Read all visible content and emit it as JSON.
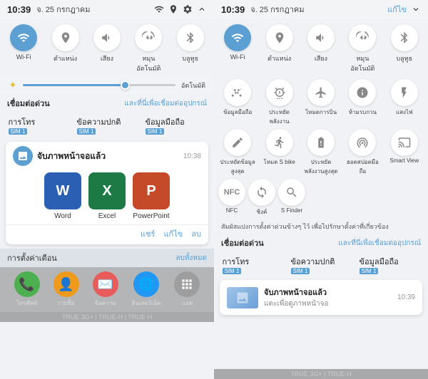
{
  "left": {
    "statusBar": {
      "time": "10:39",
      "date": "จ. 25 กรกฎาคม"
    },
    "toggles": [
      {
        "id": "wifi",
        "label": "Wi-Fi",
        "active": true
      },
      {
        "id": "location",
        "label": "ตำแหน่ง",
        "active": false
      },
      {
        "id": "sound",
        "label": "เสียง",
        "active": true
      },
      {
        "id": "auto-rotate",
        "label": "หมุนอัตโนมัติ",
        "active": false
      },
      {
        "id": "bluetooth",
        "label": "บลูทูธ",
        "active": false
      }
    ],
    "brightness": {
      "label": "อัตโนมัติ"
    },
    "connectSection": {
      "title": "เชื่อมต่อด่วน",
      "link": "และที่นี่เพื่อเชื่อมต่ออุปกรณ์"
    },
    "connections": [
      {
        "name": "การโทร",
        "sim": "SIM 1"
      },
      {
        "name": "ข้อความปกติ",
        "sim": "SIM 1"
      },
      {
        "name": "ข้อมูลมือถือ",
        "sim": "SIM 1"
      }
    ],
    "notification": {
      "title": "จับภาพหน้าจอแล้ว",
      "time": "10:38",
      "apps": [
        {
          "name": "Word",
          "icon": "W"
        },
        {
          "name": "Excel",
          "icon": "X"
        },
        {
          "name": "PowerPoint",
          "icon": "P"
        }
      ],
      "actions": [
        "แชร์",
        "แก้ไข",
        "ลบ"
      ]
    },
    "bottomBar": {
      "label": "การตั้งค่าเตือน",
      "link": "ลบทั้งหมด"
    },
    "dock": [
      {
        "label": "โทรศัพท์",
        "icon": "📞"
      },
      {
        "label": "รายชื่อ",
        "icon": "👤"
      },
      {
        "label": "ข้อความ",
        "icon": "✉️"
      },
      {
        "label": "อินเทอร์เน็ต",
        "icon": "🌐"
      },
      {
        "label": "แอพ",
        "icon": "⊞"
      }
    ],
    "statusBottom": "TRUE 3G+ | TRUE-H | TRUE-H"
  },
  "right": {
    "statusBar": {
      "time": "10:39",
      "date": "จ. 25 กรกฎาคม"
    },
    "editButton": "แก้ไข",
    "toggles": [
      {
        "id": "wifi",
        "label": "Wi-Fi",
        "active": true
      },
      {
        "id": "location",
        "label": "ตำแหน่ง",
        "active": false
      },
      {
        "id": "sound",
        "label": "เสียง",
        "active": true
      },
      {
        "id": "auto-rotate",
        "label": "หมุนอัตโนมัติ",
        "active": false
      },
      {
        "id": "bluetooth",
        "label": "บลูทูธ",
        "active": false
      }
    ],
    "extraToggles1": [
      {
        "id": "mobile-data",
        "label": "ข้อมูลมือถือ",
        "active": false
      },
      {
        "id": "power-save",
        "label": "ประหยัดพลังงาน",
        "active": false
      },
      {
        "id": "flight",
        "label": "โหมดการบิน",
        "active": false
      },
      {
        "id": "dnd",
        "label": "ห้ามรบกวน",
        "active": false
      },
      {
        "id": "torch",
        "label": "แสงไฟ",
        "active": false
      }
    ],
    "extraToggles2": [
      {
        "id": "data-save",
        "label": "ประหยัดข้อมูลสูงสุด",
        "active": false
      },
      {
        "id": "s-bike",
        "label": "โหมด S bike",
        "active": false
      },
      {
        "id": "data-save2",
        "label": "ประหยัดพลังงานสูงสุด",
        "active": false
      },
      {
        "id": "hotspot",
        "label": "ฮอตสปอตมือถือ",
        "active": false
      },
      {
        "id": "smart-view",
        "label": "Smart View",
        "active": false
      }
    ],
    "nfcRow": [
      {
        "id": "nfc",
        "label": "NFC",
        "active": false
      },
      {
        "id": "sync",
        "label": "ซิงค์",
        "active": false
      },
      {
        "id": "s-finder",
        "label": "S Finder",
        "active": false
      }
    ],
    "infoText": "สัมผัสแปงการตั้งค่าด่วนข้างๆ ไว้ เพื่อไปรักษาตั้งค่าที่เกี่ยวข้อง",
    "connectSection": {
      "title": "เชื่อมต่อด่วน",
      "link": "และที่นี่เพื่อเชื่อมต่ออุปกรณ์"
    },
    "connections": [
      {
        "name": "การโทร",
        "sim": "SIM 1"
      },
      {
        "name": "ข้อความปกติ",
        "sim": "SIM 1"
      },
      {
        "name": "ข้อมูลมือถือ",
        "sim": "SIM 1"
      }
    ],
    "notification": {
      "title": "จับภาพหน้าจอแล้ว",
      "sub": "แตะเพื่อดูภาพหน้าจอ",
      "time": "10:39"
    },
    "statusBottom": "TRUE 3G+ | TRUE-H"
  }
}
